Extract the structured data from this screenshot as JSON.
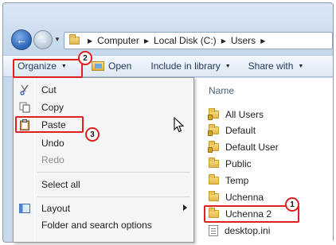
{
  "address_bar": {
    "crumbs": [
      "Computer",
      "Local Disk (C:)",
      "Users"
    ]
  },
  "toolbar": {
    "organize": "Organize",
    "open": "Open",
    "include_in_library": "Include in library",
    "share_with": "Share with"
  },
  "file_list": {
    "column_name": "Name",
    "items": [
      "All Users",
      "Default",
      "Default User",
      "Public",
      "Temp",
      "Uchenna",
      "Uchenna 2",
      "desktop.ini"
    ]
  },
  "menu": {
    "cut": "Cut",
    "copy": "Copy",
    "paste": "Paste",
    "undo": "Undo",
    "redo": "Redo",
    "select_all": "Select all",
    "layout": "Layout",
    "folder_options": "Folder and search options"
  },
  "callouts": {
    "one": "1",
    "two": "2",
    "three": "3"
  },
  "colors": {
    "callout": "#e0201f",
    "accent": "#1e395b"
  },
  "icons": {
    "back": "back-arrow-icon",
    "forward": "forward-arrow-icon",
    "cut": "scissors-icon",
    "copy": "copy-icon",
    "paste": "clipboard-icon",
    "layout": "layout-icon",
    "folder": "folder-icon",
    "file": "ini-file-icon",
    "cursor": "mouse-pointer-icon"
  }
}
